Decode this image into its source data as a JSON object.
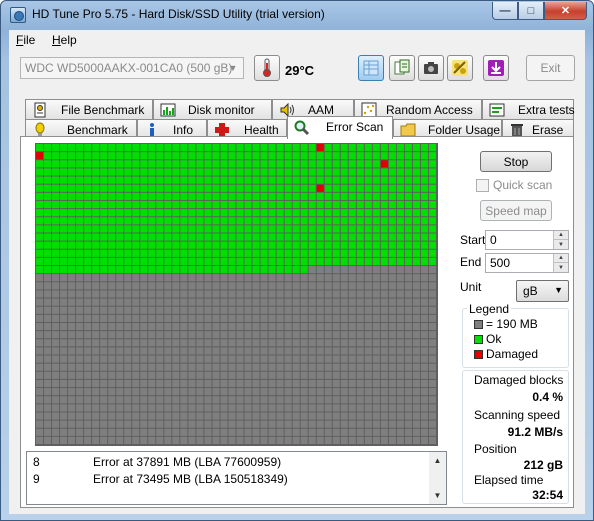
{
  "window": {
    "title": "HD Tune Pro 5.75 - Hard Disk/SSD Utility (trial version)",
    "controls": {
      "minimize": "—",
      "maximize": "□",
      "close": "✕"
    }
  },
  "menu": [
    {
      "label": "File",
      "accel": "F",
      "rest": "ile"
    },
    {
      "label": "Help",
      "accel": "H",
      "rest": "elp"
    }
  ],
  "toolbar": {
    "drive": "WDC WD5000AAKX-001CA0 (500 gB)",
    "temperature": "29°C",
    "exit_label": "Exit",
    "icons": [
      "thermometer-icon",
      "copy-icon",
      "save-icon",
      "camera-icon",
      "options-icon",
      "download-icon"
    ]
  },
  "tabs_top": [
    {
      "label": "File Benchmark",
      "icon": "file-benchmark-icon"
    },
    {
      "label": "Disk monitor",
      "icon": "disk-monitor-icon"
    },
    {
      "label": "AAM",
      "icon": "speaker-icon"
    },
    {
      "label": "Random Access",
      "icon": "random-access-icon"
    },
    {
      "label": "Extra tests",
      "icon": "extra-tests-icon"
    }
  ],
  "tabs_bottom": [
    {
      "label": "Benchmark",
      "icon": "benchmark-icon"
    },
    {
      "label": "Info",
      "icon": "info-icon"
    },
    {
      "label": "Health",
      "icon": "health-icon"
    },
    {
      "label": "Error Scan",
      "icon": "magnifier-icon",
      "selected": true
    },
    {
      "label": "Folder Usage",
      "icon": "folder-icon"
    },
    {
      "label": "Erase",
      "icon": "trash-icon"
    }
  ],
  "scan": {
    "columns": 50,
    "rows": 37,
    "scanned_fraction": 0.424,
    "damaged_blocks": [
      [
        0,
        1
      ],
      [
        35,
        0
      ],
      [
        43,
        2
      ],
      [
        50,
        2
      ],
      [
        35,
        5
      ]
    ],
    "colors": {
      "ok": "#00e000",
      "damaged": "#e00000",
      "pending": "#7f7f7f",
      "line": "#5f5f5f"
    }
  },
  "log": [
    {
      "num": "8",
      "message": "Error at 37891 MB (LBA 77600959)"
    },
    {
      "num": "9",
      "message": "Error at 73495 MB (LBA 150518349)"
    }
  ],
  "controls": {
    "stop_label": "Stop",
    "quick_scan_label": "Quick scan",
    "speed_map_label": "Speed map",
    "start_label": "Start",
    "start_value": "0",
    "end_label": "End",
    "end_value": "500",
    "unit_label": "Unit",
    "unit_value": "gB"
  },
  "legend": {
    "title": "Legend",
    "items": [
      {
        "label": "= 190 MB",
        "color": "#7f7f7f"
      },
      {
        "label": "Ok",
        "color": "#00e000"
      },
      {
        "label": "Damaged",
        "color": "#e00000"
      }
    ]
  },
  "stats": {
    "damaged_blocks_label": "Damaged blocks",
    "damaged_blocks_value": "0.4 %",
    "scanning_speed_label": "Scanning speed",
    "scanning_speed_value": "91.2 MB/s",
    "position_label": "Position",
    "position_value": "212 gB",
    "elapsed_label": "Elapsed time",
    "elapsed_value": "32:54"
  }
}
